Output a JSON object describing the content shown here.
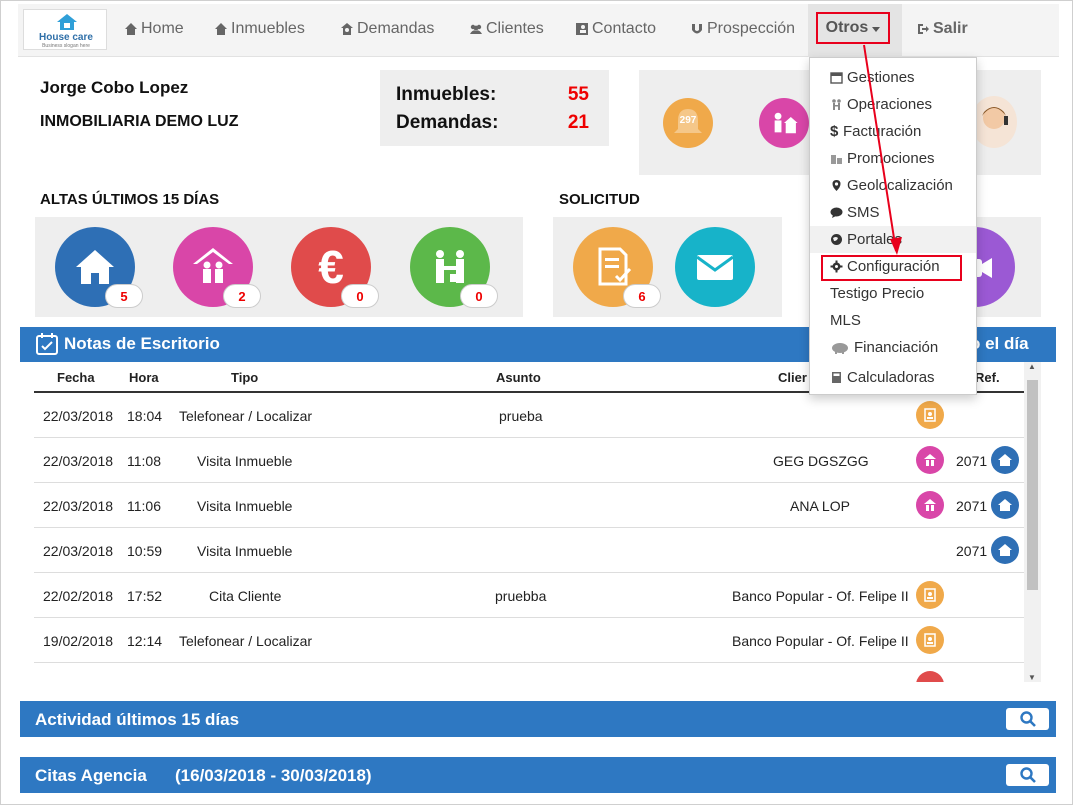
{
  "nav": {
    "logo_text": "House care",
    "logo_slogan": "Business slogan here",
    "items": [
      {
        "label": "Home",
        "icon": "home-icon"
      },
      {
        "label": "Inmuebles",
        "icon": "house-icon"
      },
      {
        "label": "Demandas",
        "icon": "person-house-icon"
      },
      {
        "label": "Clientes",
        "icon": "users-icon"
      },
      {
        "label": "Contacto",
        "icon": "contact-card-icon"
      },
      {
        "label": "Prospección",
        "icon": "magnet-icon"
      }
    ],
    "otros_label": "Otros",
    "salir_label": "Salir"
  },
  "header": {
    "user_name": "Jorge Cobo Lopez",
    "agency": "INMOBILIARIA DEMO LUZ",
    "inmuebles_label": "Inmuebles:",
    "inmuebles_value": "55",
    "demandas_label": "Demandas:",
    "demandas_value": "21",
    "alarm_count": "297"
  },
  "altas": {
    "title": "ALTAS ÚLTIMOS 15 DÍAS",
    "tiles": [
      {
        "icon": "house-icon",
        "count": "5",
        "color": "#2e6fb5"
      },
      {
        "icon": "family-house-icon",
        "count": "2",
        "color": "#d946a8"
      },
      {
        "icon": "euro-icon",
        "count": "0",
        "color": "#e04b4b"
      },
      {
        "icon": "handshake-icon",
        "count": "0",
        "color": "#5cb84a"
      }
    ]
  },
  "solicitud": {
    "title": "SOLICITUD",
    "tiles": [
      {
        "icon": "document-check-icon",
        "count": "6",
        "color": "#f0a94a"
      },
      {
        "icon": "envelope-icon",
        "count": "",
        "color": "#17b3c9"
      }
    ]
  },
  "notas": {
    "title": "Notas de Escritorio",
    "right_title_fragment": "o el día",
    "columns": [
      "Fecha",
      "Hora",
      "Tipo",
      "Asunto",
      "Clier",
      "Ref."
    ],
    "rows": [
      {
        "fecha": "22/03/2018",
        "hora": "18:04",
        "tipo": "Telefonear / Localizar",
        "asunto": "prueba",
        "cliente": "",
        "icon": "contact-card-icon",
        "ref": ""
      },
      {
        "fecha": "22/03/2018",
        "hora": "11:08",
        "tipo": "Visita Inmueble",
        "asunto": "",
        "cliente": "GEG DGSZGG",
        "icon": "family-house-icon",
        "ref": "2071"
      },
      {
        "fecha": "22/03/2018",
        "hora": "11:06",
        "tipo": "Visita Inmueble",
        "asunto": "",
        "cliente": "ANA LOP",
        "icon": "family-house-icon",
        "ref": "2071"
      },
      {
        "fecha": "22/03/2018",
        "hora": "10:59",
        "tipo": "Visita Inmueble",
        "asunto": "",
        "cliente": "",
        "icon": "",
        "ref": "2071"
      },
      {
        "fecha": "22/02/2018",
        "hora": "17:52",
        "tipo": "Cita Cliente",
        "asunto": "pruebba",
        "cliente": "Banco Popular - Of. Felipe II",
        "icon": "contact-card-icon",
        "ref": ""
      },
      {
        "fecha": "19/02/2018",
        "hora": "12:14",
        "tipo": "Telefonear / Localizar",
        "asunto": "",
        "cliente": "Banco Popular - Of. Felipe II",
        "icon": "contact-card-icon",
        "ref": ""
      }
    ]
  },
  "actividad": {
    "title": "Actividad últimos 15 días"
  },
  "citas": {
    "title": "Citas Agencia",
    "range": "(16/03/2018 - 30/03/2018)"
  },
  "dropdown": {
    "items": [
      {
        "label": "Gestiones",
        "icon": "calendar-icon"
      },
      {
        "label": "Operaciones",
        "icon": "operations-icon"
      },
      {
        "label": "Facturación",
        "icon": "dollar-icon"
      },
      {
        "label": "Promociones",
        "icon": "buildings-icon"
      },
      {
        "label": "Geolocalización",
        "icon": "map-marker-icon"
      },
      {
        "label": "SMS",
        "icon": "speech-bubble-icon"
      },
      {
        "label": "Portales",
        "icon": "globe-icon"
      },
      {
        "label": "Configuración",
        "icon": "gear-icon"
      },
      {
        "label": "Testigo Precio",
        "icon": ""
      },
      {
        "label": "MLS",
        "icon": ""
      },
      {
        "label": "Financiación",
        "icon": "piggy-bank-icon"
      },
      {
        "label": "Calculadoras",
        "icon": "calculator-icon"
      }
    ]
  }
}
